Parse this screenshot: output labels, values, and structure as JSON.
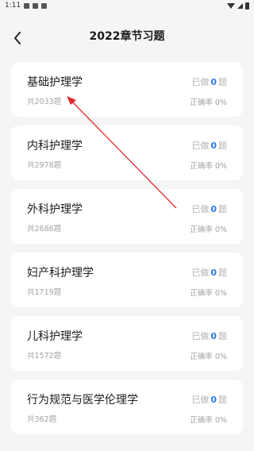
{
  "status_bar": {
    "time": "1:11"
  },
  "header": {
    "title": "2022章节习题"
  },
  "chapters": [
    {
      "name": "基础护理学",
      "total": "共2033题",
      "done_prefix": "已做",
      "done_count": "0",
      "done_suffix": "题",
      "accuracy": "正确率 0%"
    },
    {
      "name": "内科护理学",
      "total": "共2978题",
      "done_prefix": "已做",
      "done_count": "0",
      "done_suffix": "题",
      "accuracy": "正确率 0%"
    },
    {
      "name": "外科护理学",
      "total": "共2686题",
      "done_prefix": "已做",
      "done_count": "0",
      "done_suffix": "题",
      "accuracy": "正确率 0%"
    },
    {
      "name": "妇产科护理学",
      "total": "共1719题",
      "done_prefix": "已做",
      "done_count": "0",
      "done_suffix": "题",
      "accuracy": "正确率 0%"
    },
    {
      "name": "儿科护理学",
      "total": "共1572题",
      "done_prefix": "已做",
      "done_count": "0",
      "done_suffix": "题",
      "accuracy": "正确率 0%"
    },
    {
      "name": "行为规范与医学伦理学",
      "total": "共362题",
      "done_prefix": "已做",
      "done_count": "0",
      "done_suffix": "题",
      "accuracy": "正确率 0%"
    }
  ],
  "colors": {
    "accent": "#2b7de9",
    "annotation_arrow": "#e0262b"
  }
}
